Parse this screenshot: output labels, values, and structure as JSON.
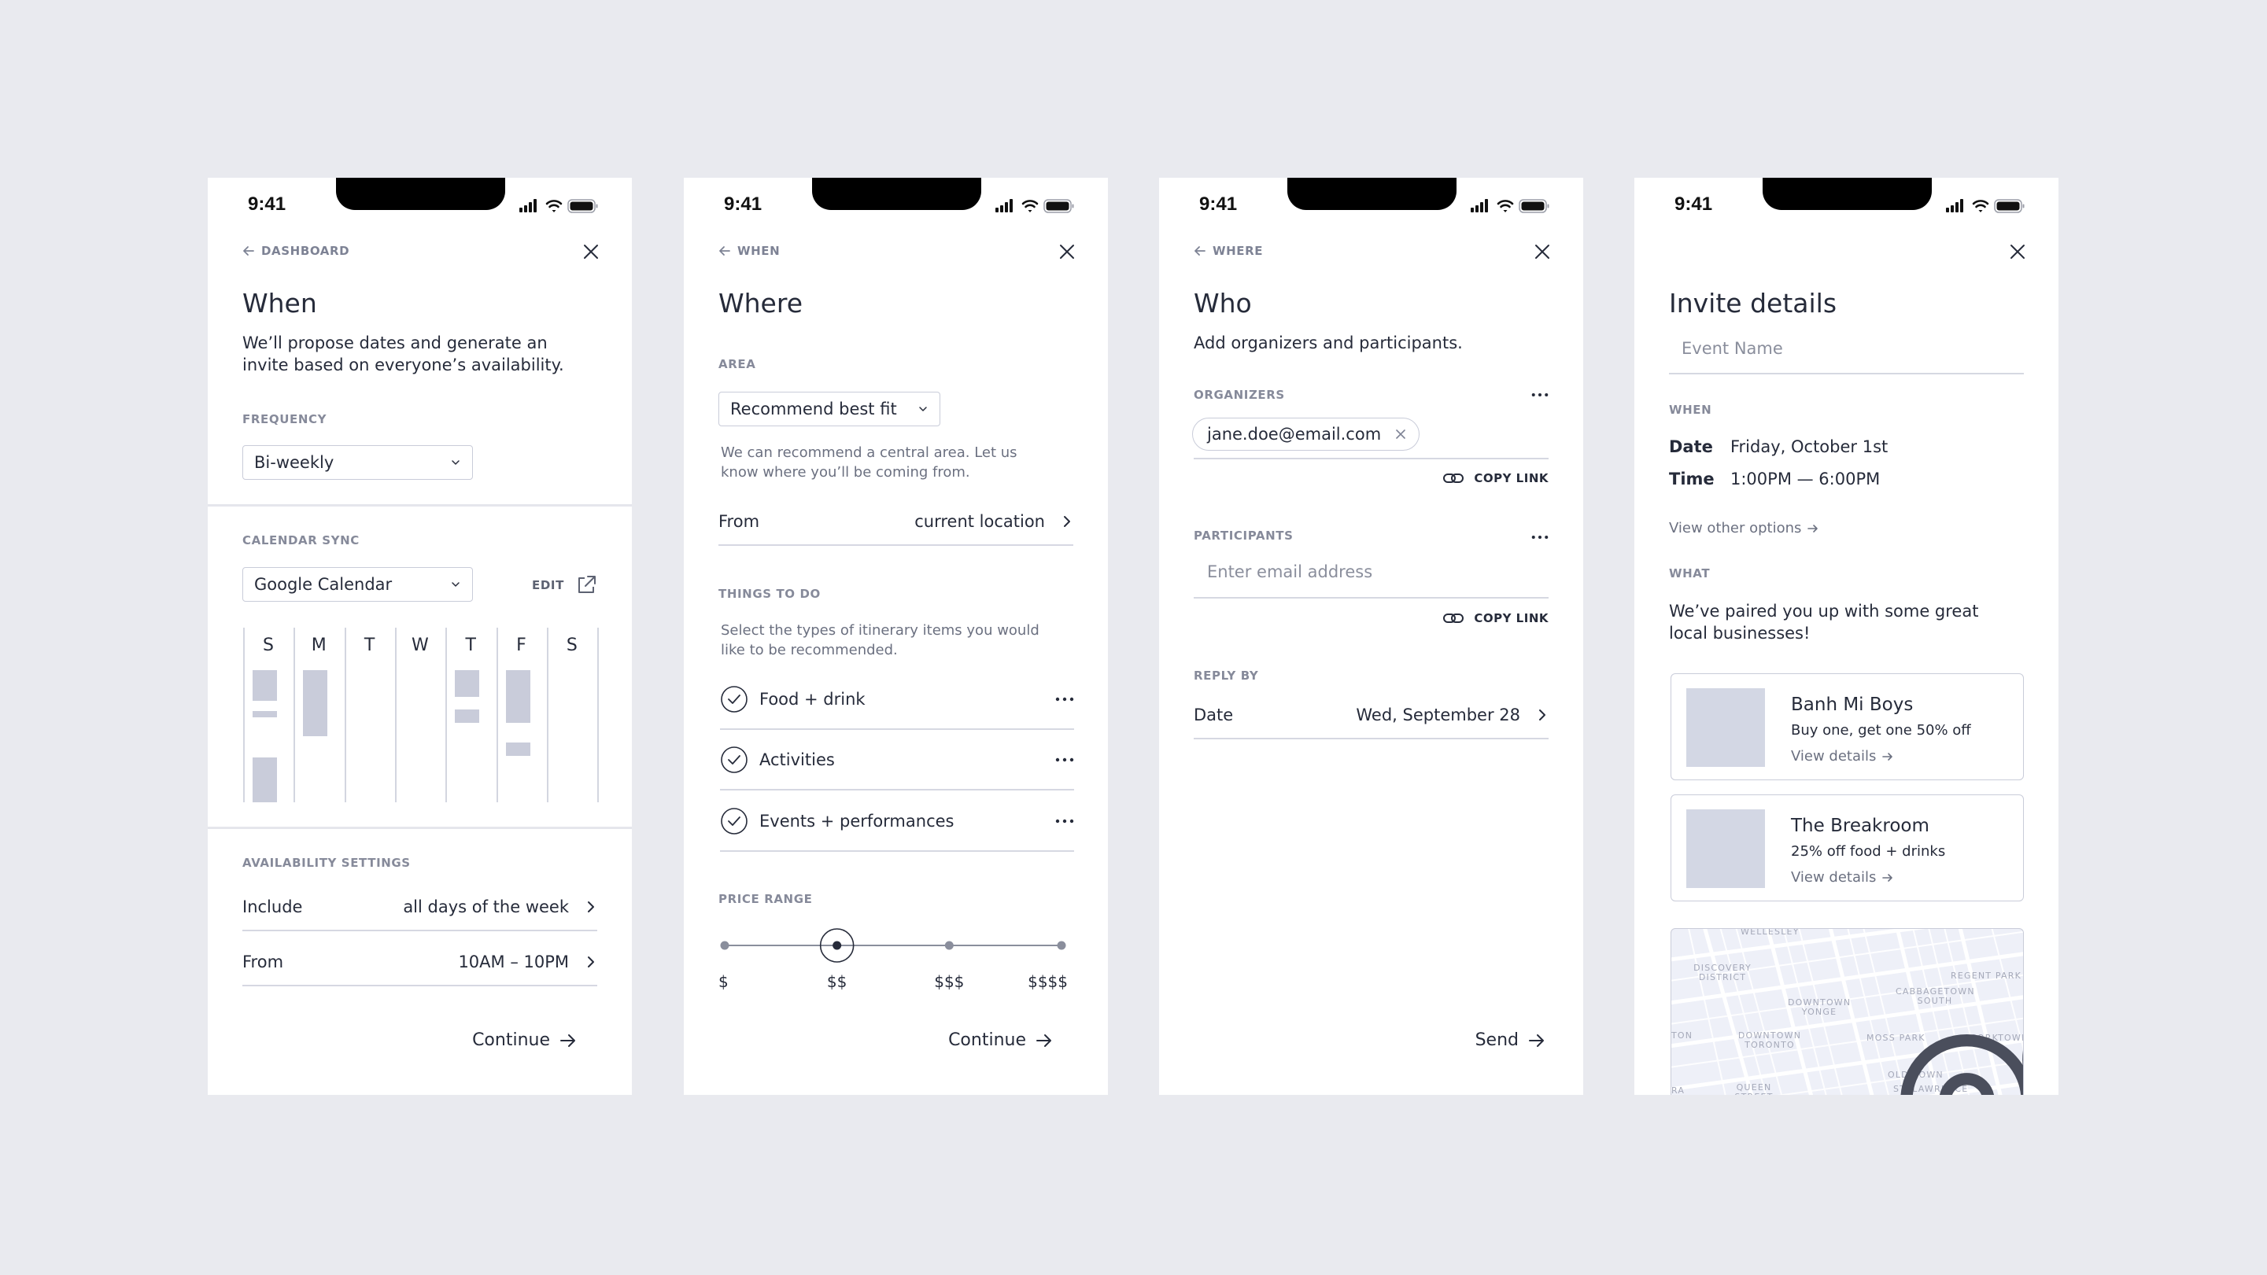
{
  "status_bar": {
    "time": "9:41"
  },
  "screens": {
    "when": {
      "back_label": "DASHBOARD",
      "title": "When",
      "description": "We’ll propose dates and generate an invite based on everyone’s availability.",
      "frequency": {
        "label": "FREQUENCY",
        "value": "Bi-weekly"
      },
      "calendar_sync": {
        "label": "CALENDAR SYNC",
        "value": "Google Calendar",
        "edit_label": "EDIT",
        "days": [
          "S",
          "M",
          "T",
          "W",
          "T",
          "F",
          "S"
        ],
        "busy_blocks_hours_fraction": [
          [
            [
              0.0,
              0.23
            ],
            [
              0.31,
              0.36
            ],
            [
              0.66,
              1.0
            ]
          ],
          [
            [
              0.0,
              0.5
            ]
          ],
          [],
          [],
          [
            [
              0.0,
              0.2
            ],
            [
              0.3,
              0.4
            ]
          ],
          [
            [
              0.0,
              0.4
            ],
            [
              0.55,
              0.65
            ]
          ],
          []
        ]
      },
      "availability": {
        "label": "AVAILABILITY SETTINGS",
        "rows": [
          {
            "label": "Include",
            "value": "all days of the week"
          },
          {
            "label": "From",
            "value": "10AM – 10PM"
          }
        ]
      },
      "continue_label": "Continue"
    },
    "where": {
      "back_label": "WHEN",
      "title": "Where",
      "area": {
        "label": "AREA",
        "value": "Recommend best fit",
        "help": "We can recommend a central area. Let us know where you’ll be coming from."
      },
      "from_row": {
        "label": "From",
        "value": "current location"
      },
      "things_to_do": {
        "label": "THINGS TO DO",
        "help": "Select the types of itinerary items you would like to be recommended.",
        "items": [
          {
            "label": "Food + drink",
            "checked": true
          },
          {
            "label": "Activities",
            "checked": true
          },
          {
            "label": "Events + performances",
            "checked": true
          }
        ]
      },
      "price_range": {
        "label": "PRICE RANGE",
        "options": [
          "$",
          "$$",
          "$$$",
          "$$$$"
        ],
        "selected_index": 1
      },
      "continue_label": "Continue"
    },
    "who": {
      "back_label": "WHERE",
      "title": "Who",
      "description": "Add organizers and participants.",
      "organizers": {
        "label": "ORGANIZERS",
        "chips": [
          "jane.doe@email.com"
        ],
        "copy_link_label": "COPY LINK"
      },
      "participants": {
        "label": "PARTICIPANTS",
        "placeholder": "Enter email address",
        "copy_link_label": "COPY LINK"
      },
      "reply_by": {
        "label": "REPLY BY",
        "row": {
          "label": "Date",
          "value": "Wed, September 28"
        }
      },
      "send_label": "Send"
    },
    "invite": {
      "title": "Invite details",
      "event_name_placeholder": "Event Name",
      "when": {
        "label": "WHEN",
        "date_label": "Date",
        "date_value": "Friday, October 1st",
        "time_label": "Time",
        "time_value": "1:00PM — 6:00PM",
        "other_options_label": "View other options"
      },
      "what": {
        "label": "WHAT",
        "description": "We’ve paired you up with some great local businesses!",
        "businesses": [
          {
            "name": "Banh Mi Boys",
            "offer": "Buy one, get one 50% off",
            "link": "View details"
          },
          {
            "name": "The Breakroom",
            "offer": "25% off food + drinks",
            "link": "View details"
          }
        ]
      },
      "map": {
        "labels": [
          "WELLESLEY",
          "DISCOVERY DISTRICT",
          "DOWNTOWN YONGE",
          "REGENT PARK",
          "CABBAGETOWN SOUTH",
          "DOWNTOWN TORONTO",
          "MOSS PARK",
          "CORKTOWN",
          "OLD TOWN",
          "ST. LAWRENCE",
          "QUEEN STREET WEST",
          "TON",
          "RA"
        ]
      }
    }
  },
  "colors": {
    "background": "#e9eaef",
    "text": "#262b3a",
    "muted": "#868a9a",
    "divider": "#d6d8e2",
    "busy": "#c9ccda"
  }
}
